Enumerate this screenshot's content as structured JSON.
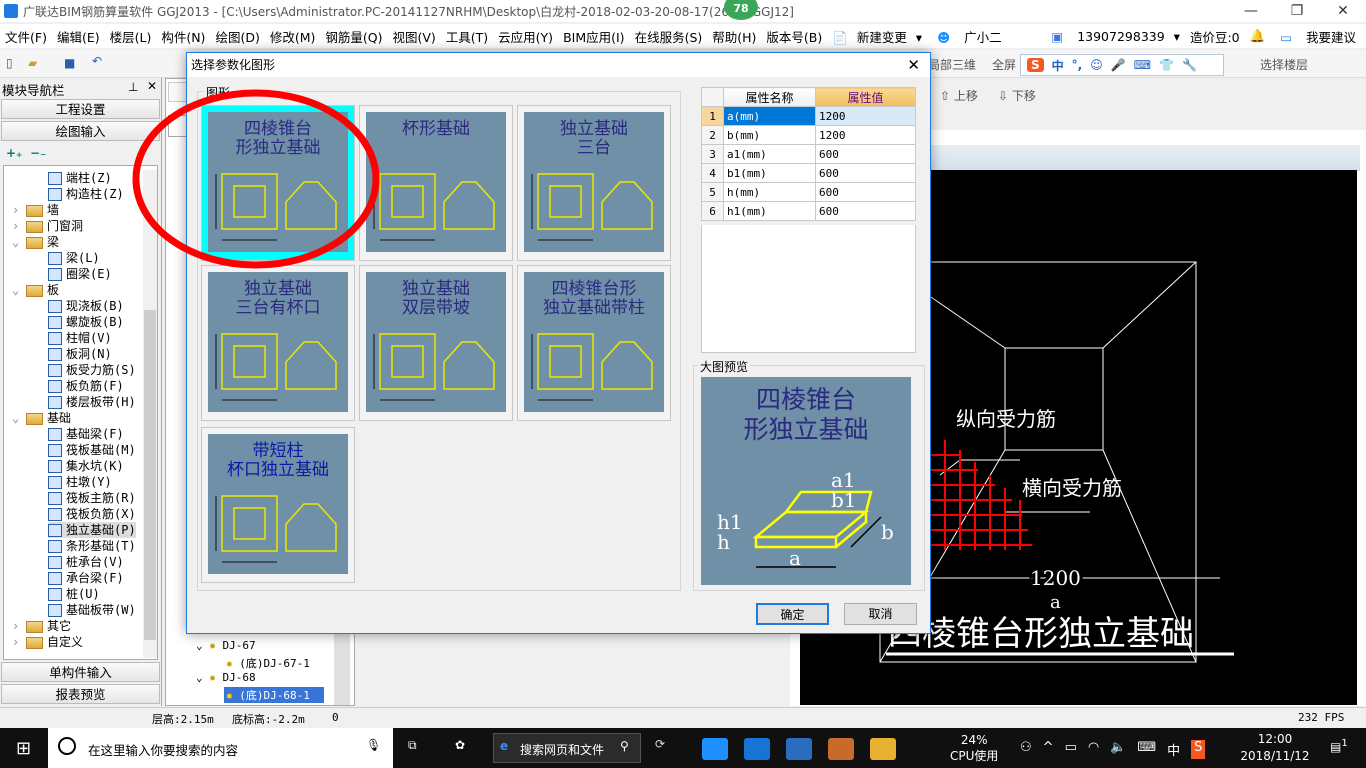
{
  "window": {
    "title": "广联达BIM钢筋算量软件 GGJ2013 - [C:\\Users\\Administrator.PC-20141127NRHM\\Desktop\\白龙村-2018-02-03-20-08-17(266... GGJ12]",
    "badge": "78"
  },
  "menu": [
    "文件(F)",
    "编辑(E)",
    "楼层(L)",
    "构件(N)",
    "绘图(D)",
    "修改(M)",
    "钢筋量(Q)",
    "视图(V)",
    "工具(T)",
    "云应用(Y)",
    "BIM应用(I)",
    "在线服务(S)",
    "帮助(H)",
    "版本号(B)"
  ],
  "menu_extra": {
    "new_change": "新建变更",
    "assistant": "广小二",
    "account": "13907298339",
    "beans": "造价豆:0",
    "feedback": "我要建议"
  },
  "toolbar": {
    "local_3d": "局部三维",
    "full": "全屏",
    "select_floor": "选择楼层",
    "move_up": "上移",
    "move_down": "下移",
    "ime": [
      "中",
      "°,"
    ]
  },
  "nav": {
    "title": "模块导航栏",
    "project_settings": "工程设置",
    "drawing_input": "绘图输入",
    "single_input": "单构件输入",
    "report_preview": "报表预览",
    "tree": [
      {
        "label": "端柱(Z)",
        "level": 2
      },
      {
        "label": "构造柱(Z)",
        "level": 2
      },
      {
        "label": "墙",
        "level": 1,
        "folder": true,
        "expanded": false
      },
      {
        "label": "门窗洞",
        "level": 1,
        "folder": true,
        "expanded": false
      },
      {
        "label": "梁",
        "level": 1,
        "folder": true,
        "expanded": true
      },
      {
        "label": "梁(L)",
        "level": 2
      },
      {
        "label": "圈梁(E)",
        "level": 2
      },
      {
        "label": "板",
        "level": 1,
        "folder": true,
        "expanded": true
      },
      {
        "label": "现浇板(B)",
        "level": 2
      },
      {
        "label": "螺旋板(B)",
        "level": 2
      },
      {
        "label": "柱帽(V)",
        "level": 2
      },
      {
        "label": "板洞(N)",
        "level": 2
      },
      {
        "label": "板受力筋(S)",
        "level": 2
      },
      {
        "label": "板负筋(F)",
        "level": 2
      },
      {
        "label": "楼层板带(H)",
        "level": 2
      },
      {
        "label": "基础",
        "level": 1,
        "folder": true,
        "expanded": true
      },
      {
        "label": "基础梁(F)",
        "level": 2
      },
      {
        "label": "筏板基础(M)",
        "level": 2
      },
      {
        "label": "集水坑(K)",
        "level": 2
      },
      {
        "label": "柱墩(Y)",
        "level": 2
      },
      {
        "label": "筏板主筋(R)",
        "level": 2
      },
      {
        "label": "筏板负筋(X)",
        "level": 2
      },
      {
        "label": "独立基础(P)",
        "level": 2,
        "selected": true
      },
      {
        "label": "条形基础(T)",
        "level": 2
      },
      {
        "label": "桩承台(V)",
        "level": 2
      },
      {
        "label": "承台梁(F)",
        "level": 2
      },
      {
        "label": "桩(U)",
        "level": 2
      },
      {
        "label": "基础板带(W)",
        "level": 2
      },
      {
        "label": "其它",
        "level": 1,
        "folder": true,
        "expanded": false
      },
      {
        "label": "自定义",
        "level": 1,
        "folder": true,
        "expanded": false
      }
    ]
  },
  "component_tree": [
    {
      "label": "DJ-67"
    },
    {
      "label": "(底)DJ-67-1"
    },
    {
      "label": "DJ-68"
    },
    {
      "label": "(底)DJ-68-1",
      "selected": true
    }
  ],
  "dialog": {
    "title": "选择参数化图形",
    "group_shapes": "图形",
    "group_preview": "大图预览",
    "ok": "确定",
    "cancel": "取消",
    "shapes": [
      {
        "title": "四棱锥台\n形独立基础",
        "selected": true
      },
      {
        "title": "杯形基础"
      },
      {
        "title": "独立基础\n三台"
      },
      {
        "title": "独立基础\n三台有杯口"
      },
      {
        "title": "独立基础\n双层带坡"
      },
      {
        "title": "四棱锥台形\n独立基础带柱"
      },
      {
        "title": "带短柱\n杯口独立基础"
      }
    ],
    "table": {
      "headers": [
        "属性名称",
        "属性值"
      ],
      "rows": [
        [
          "1",
          "a(mm)",
          "1200"
        ],
        [
          "2",
          "b(mm)",
          "1200"
        ],
        [
          "3",
          "a1(mm)",
          "600"
        ],
        [
          "4",
          "b1(mm)",
          "600"
        ],
        [
          "5",
          "h(mm)",
          "600"
        ],
        [
          "6",
          "h1(mm)",
          "600"
        ]
      ]
    },
    "preview_title": "四棱锥台\n形独立基础",
    "preview_labels": {
      "a": "a",
      "b": "b",
      "a1": "a1",
      "b1": "b1",
      "h": "h",
      "h1": "h1"
    }
  },
  "cad": {
    "long_rebar": "纵向受力筋",
    "trans_rebar": "横向受力筋",
    "dim": "1200",
    "dim_label": "a",
    "title": "四棱锥台形独立基础"
  },
  "status": {
    "floor_height": "层高:2.15m",
    "bottom_elev": "底标高:-2.2m",
    "value": "0",
    "fps": "232 FPS"
  },
  "taskbar": {
    "search_placeholder": "在这里输入你要搜索的内容",
    "browser_search": "搜索网页和文件",
    "cpu": "24%",
    "cpu_label": "CPU使用",
    "ime": "中",
    "time": "12:00",
    "date": "2018/11/12",
    "notifications": "1"
  },
  "colors": {
    "accent": "#0078d7",
    "selection_cyan": "#00ffff",
    "thumb_bg": "#6f90a6",
    "annotation_red": "#ff0000",
    "header_orange": "#f5c56a"
  }
}
